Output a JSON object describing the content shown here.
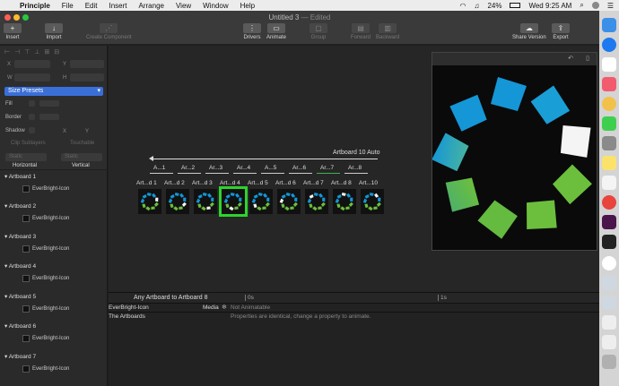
{
  "menubar": {
    "app": "Principle",
    "items": [
      "File",
      "Edit",
      "Insert",
      "Arrange",
      "View",
      "Window",
      "Help"
    ],
    "battery": "24%",
    "clock": "Wed 9:25 AM"
  },
  "window": {
    "title": "Untitled 3",
    "edited": "— Edited"
  },
  "toolbar": {
    "insert": "Insert",
    "import": "Import",
    "create_component": "Create Component",
    "drivers": "Drivers",
    "animate": "Animate",
    "group": "Group",
    "forward": "Forward",
    "backward": "Backward",
    "share_version": "Share Version",
    "export": "Export"
  },
  "inspector": {
    "x": "X",
    "y": "Y",
    "w": "W",
    "h": "H",
    "size_presets": "Size Presets",
    "fill": "Fill",
    "border": "Border",
    "shadow": "Shadow",
    "shadow_x": "X",
    "shadow_y": "Y",
    "clip_sublayers": "Clip Sublayers",
    "touchable": "Touchable",
    "static1": "Static",
    "static2": "Static",
    "horizontal": "Horizontal",
    "vertical": "Vertical"
  },
  "layers": [
    {
      "name": "Artboard 1",
      "child": "EverBright-Icon"
    },
    {
      "name": "Artboard 2",
      "child": "EverBright-Icon"
    },
    {
      "name": "Artboard 3",
      "child": "EverBright-Icon"
    },
    {
      "name": "Artboard 4",
      "child": "EverBright-Icon"
    },
    {
      "name": "Artboard 5",
      "child": "EverBright-Icon"
    },
    {
      "name": "Artboard 6",
      "child": "EverBright-Icon"
    },
    {
      "name": "Artboard 7",
      "child": "EverBright-Icon"
    }
  ],
  "canvas": {
    "flow_label": "Artboard 10 Auto",
    "connections": [
      "A...1",
      "Ar...2",
      "Ar...3",
      "Ar...4",
      "A...5",
      "Ar...6",
      "Ar...7",
      "Ar...8"
    ],
    "artboards": [
      "Art...d 1",
      "Art...d 2",
      "Art...d 3",
      "Art...d 4",
      "Art...d 5",
      "Art...d 6",
      "Art...d 7",
      "Art...d 8",
      "Art...10"
    ]
  },
  "timeline": {
    "transition": "Any Artboard to Artboard 8",
    "t0": "0s",
    "t1": "1s",
    "layer": "EverBright-Icon",
    "media": "Media",
    "not_animatable": "Not Animatable",
    "group": "The Artboards",
    "message": "Properties are identical, change a property to animate."
  },
  "colors": {
    "accent": "#3a6fd8",
    "selection": "#2ed32e",
    "blue": "#1596d6",
    "green": "#6cbf3d"
  }
}
